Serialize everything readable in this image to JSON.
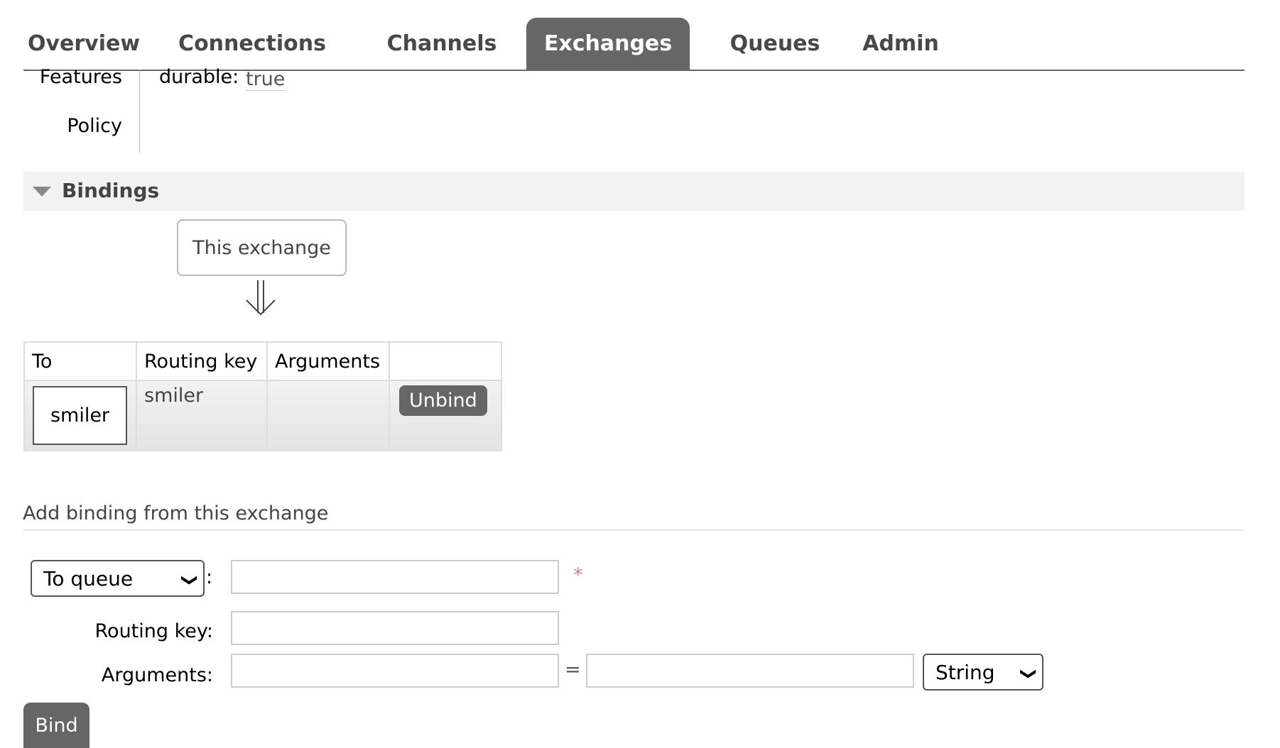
{
  "tabs": {
    "overview": "Overview",
    "connections": "Connections",
    "channels": "Channels",
    "exchanges": "Exchanges",
    "queues": "Queues",
    "admin": "Admin",
    "active": "Exchanges"
  },
  "details": {
    "features_label": "Features",
    "features_key": "durable:",
    "features_value": "true",
    "policy_label": "Policy"
  },
  "bindings": {
    "title": "Bindings",
    "this_exchange": "This exchange",
    "columns": [
      "To",
      "Routing key",
      "Arguments",
      ""
    ],
    "rows": [
      {
        "to": "smiler",
        "routing_key": "smiler",
        "arguments": "",
        "action": "Unbind"
      }
    ]
  },
  "add_binding": {
    "title": "Add binding from this exchange",
    "destination_type": "To queue",
    "colon": ":",
    "required_marker": "*",
    "routing_key_label": "Routing key:",
    "arguments_label": "Arguments:",
    "equals": "=",
    "argument_type": "String",
    "bind_label": "Bind"
  },
  "colors": {
    "tab_active_bg": "#666666",
    "button_bg": "#666666",
    "required": "#e07b7b"
  }
}
